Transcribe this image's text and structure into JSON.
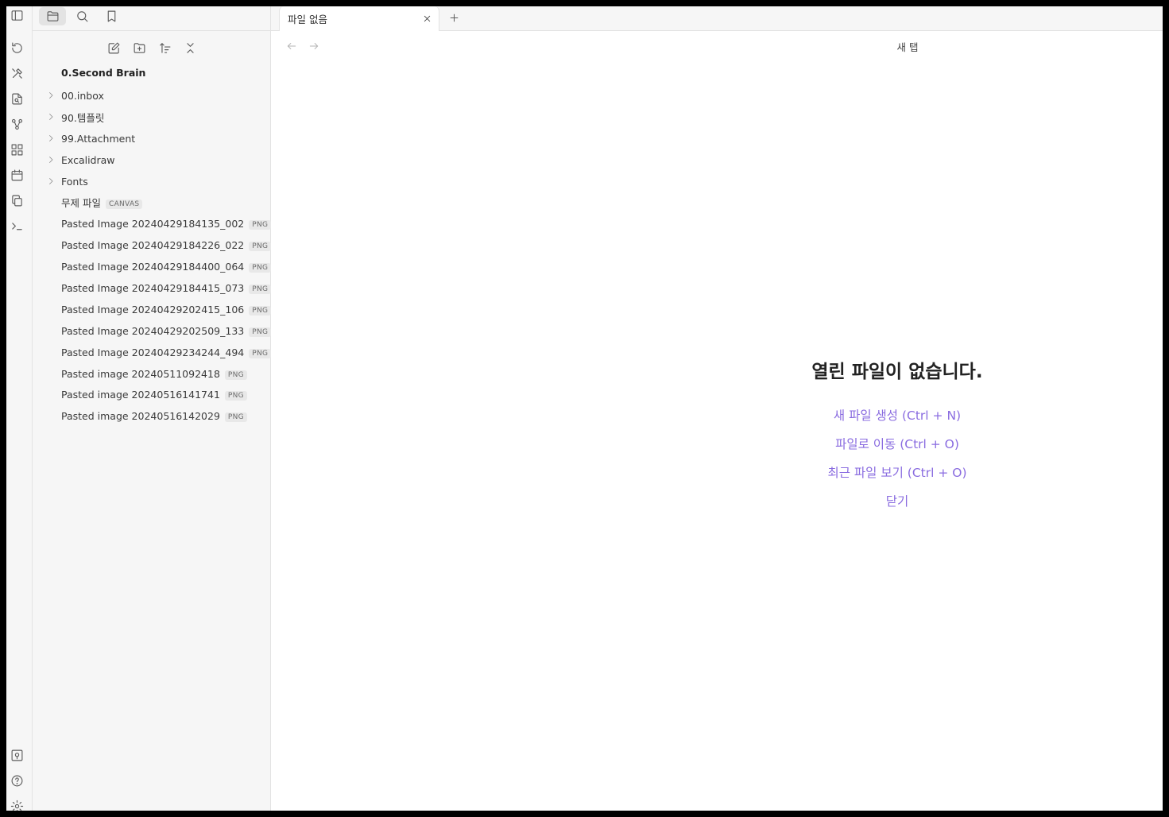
{
  "ribbon": {
    "top_icons": [
      "sidebar-toggle-icon",
      "sync-icon",
      "templater-icon",
      "file-search-icon",
      "graph-icon",
      "plugins-grid-icon",
      "calendar-icon",
      "copy-icon",
      "terminal-icon"
    ],
    "bottom_icons": [
      "vault-switch-icon",
      "help-icon",
      "settings-icon"
    ]
  },
  "sidebar": {
    "tabs": [
      "folder-icon",
      "search-icon",
      "bookmark-icon"
    ],
    "actions": [
      "new-note-icon",
      "new-folder-icon",
      "sort-icon",
      "collapse-icon"
    ],
    "vault_name": "0.Second Brain",
    "folders": [
      "00.inbox",
      "90.템플릿",
      "99.Attachment",
      "Excalidraw",
      "Fonts"
    ],
    "files": [
      {
        "name": "무제 파일",
        "ext": "CANVAS"
      },
      {
        "name": "Pasted Image 20240429184135_002",
        "ext": "PNG"
      },
      {
        "name": "Pasted Image 20240429184226_022",
        "ext": "PNG"
      },
      {
        "name": "Pasted Image 20240429184400_064",
        "ext": "PNG"
      },
      {
        "name": "Pasted Image 20240429184415_073",
        "ext": "PNG"
      },
      {
        "name": "Pasted Image 20240429202415_106",
        "ext": "PNG"
      },
      {
        "name": "Pasted Image 20240429202509_133",
        "ext": "PNG"
      },
      {
        "name": "Pasted Image 20240429234244_494",
        "ext": "PNG"
      },
      {
        "name": "Pasted image 20240511092418",
        "ext": "PNG"
      },
      {
        "name": "Pasted image 20240516141741",
        "ext": "PNG"
      },
      {
        "name": "Pasted image 20240516142029",
        "ext": "PNG"
      }
    ]
  },
  "tabbar": {
    "tab_title": "파일 없음"
  },
  "view": {
    "title": "새 탭"
  },
  "empty_state": {
    "title": "열린 파일이 없습니다.",
    "actions": [
      "새 파일 생성 (Ctrl + N)",
      "파일로 이동 (Ctrl + O)",
      "최근 파일 보기 (Ctrl + O)",
      "닫기"
    ]
  },
  "colors": {
    "accent": "#8a6ce0",
    "sidebar_bg": "#f6f6f6"
  }
}
